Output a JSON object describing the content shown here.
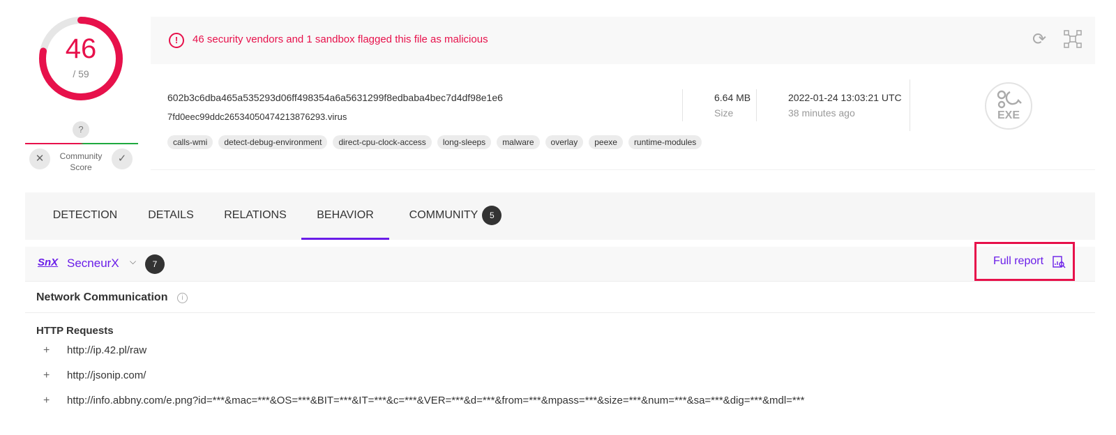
{
  "score": {
    "detected": "46",
    "total": "/ 59",
    "ring_fraction": 0.78
  },
  "community": {
    "question": "?",
    "label": "Community Score",
    "down": "✕",
    "up": "✓"
  },
  "alert": {
    "text": "46 security vendors and 1 sandbox flagged this file as malicious",
    "icon": "!"
  },
  "file": {
    "hash": "602b3c6dba465a535293d06ff498354a6a5631299f8edbaba4bec7d4df98e1e6",
    "name": "7fd0eec99ddc26534050474213876293.virus",
    "tags": [
      "calls-wmi",
      "detect-debug-environment",
      "direct-cpu-clock-access",
      "long-sleeps",
      "malware",
      "overlay",
      "peexe",
      "runtime-modules"
    ],
    "size_value": "6.64 MB",
    "size_label": "Size",
    "date": "2022-01-24 13:03:21 UTC",
    "date_relative": "38 minutes ago",
    "type_label": "EXE"
  },
  "tabs": [
    {
      "label": "DETECTION"
    },
    {
      "label": "DETAILS"
    },
    {
      "label": "RELATIONS"
    },
    {
      "label": "BEHAVIOR"
    },
    {
      "label": "COMMUNITY",
      "badge": "5"
    }
  ],
  "sandbox": {
    "logo": "SnX",
    "name": "SecneurX",
    "count": "7",
    "full_report": "Full report"
  },
  "section": {
    "title": "Network Communication",
    "info": "i",
    "subtitle": "HTTP Requests"
  },
  "requests": [
    "http://ip.42.pl/raw",
    "http://jsonip.com/",
    "http://info.abbny.com/e.png?id=***&mac=***&OS=***&BIT=***&IT=***&c=***&VER=***&d=***&from=***&mpass=***&size=***&num=***&sa=***&dig=***&mdl=***"
  ],
  "colors": {
    "accent": "#6a1de8",
    "danger": "#e7114b",
    "safe": "#1ea93f"
  },
  "icons": {
    "refresh": "refresh-icon",
    "graph": "graph-summary-icon",
    "report": "report-search-icon",
    "plus": "+"
  }
}
